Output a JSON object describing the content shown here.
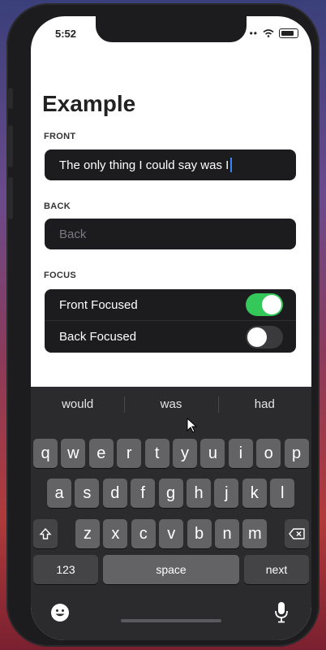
{
  "status": {
    "time": "5:52"
  },
  "page": {
    "title": "Example"
  },
  "front": {
    "label": "FRONT",
    "value": "The only thing I could say was I"
  },
  "back": {
    "label": "BACK",
    "placeholder": "Back"
  },
  "focus": {
    "label": "FOCUS",
    "front_focused": {
      "label": "Front Focused",
      "on": true
    },
    "back_focused": {
      "label": "Back Focused",
      "on": false
    }
  },
  "keyboard": {
    "suggestions": [
      "would",
      "was",
      "had"
    ],
    "row1": [
      "q",
      "w",
      "e",
      "r",
      "t",
      "y",
      "u",
      "i",
      "o",
      "p"
    ],
    "row2": [
      "a",
      "s",
      "d",
      "f",
      "g",
      "h",
      "j",
      "k",
      "l"
    ],
    "row3": [
      "z",
      "x",
      "c",
      "v",
      "b",
      "n",
      "m"
    ],
    "numbers_key": "123",
    "space_key": "space",
    "return_key": "next"
  },
  "colors": {
    "toggle_on": "#34c759",
    "caret": "#3a82f7",
    "field_bg": "#1c1c1e"
  }
}
